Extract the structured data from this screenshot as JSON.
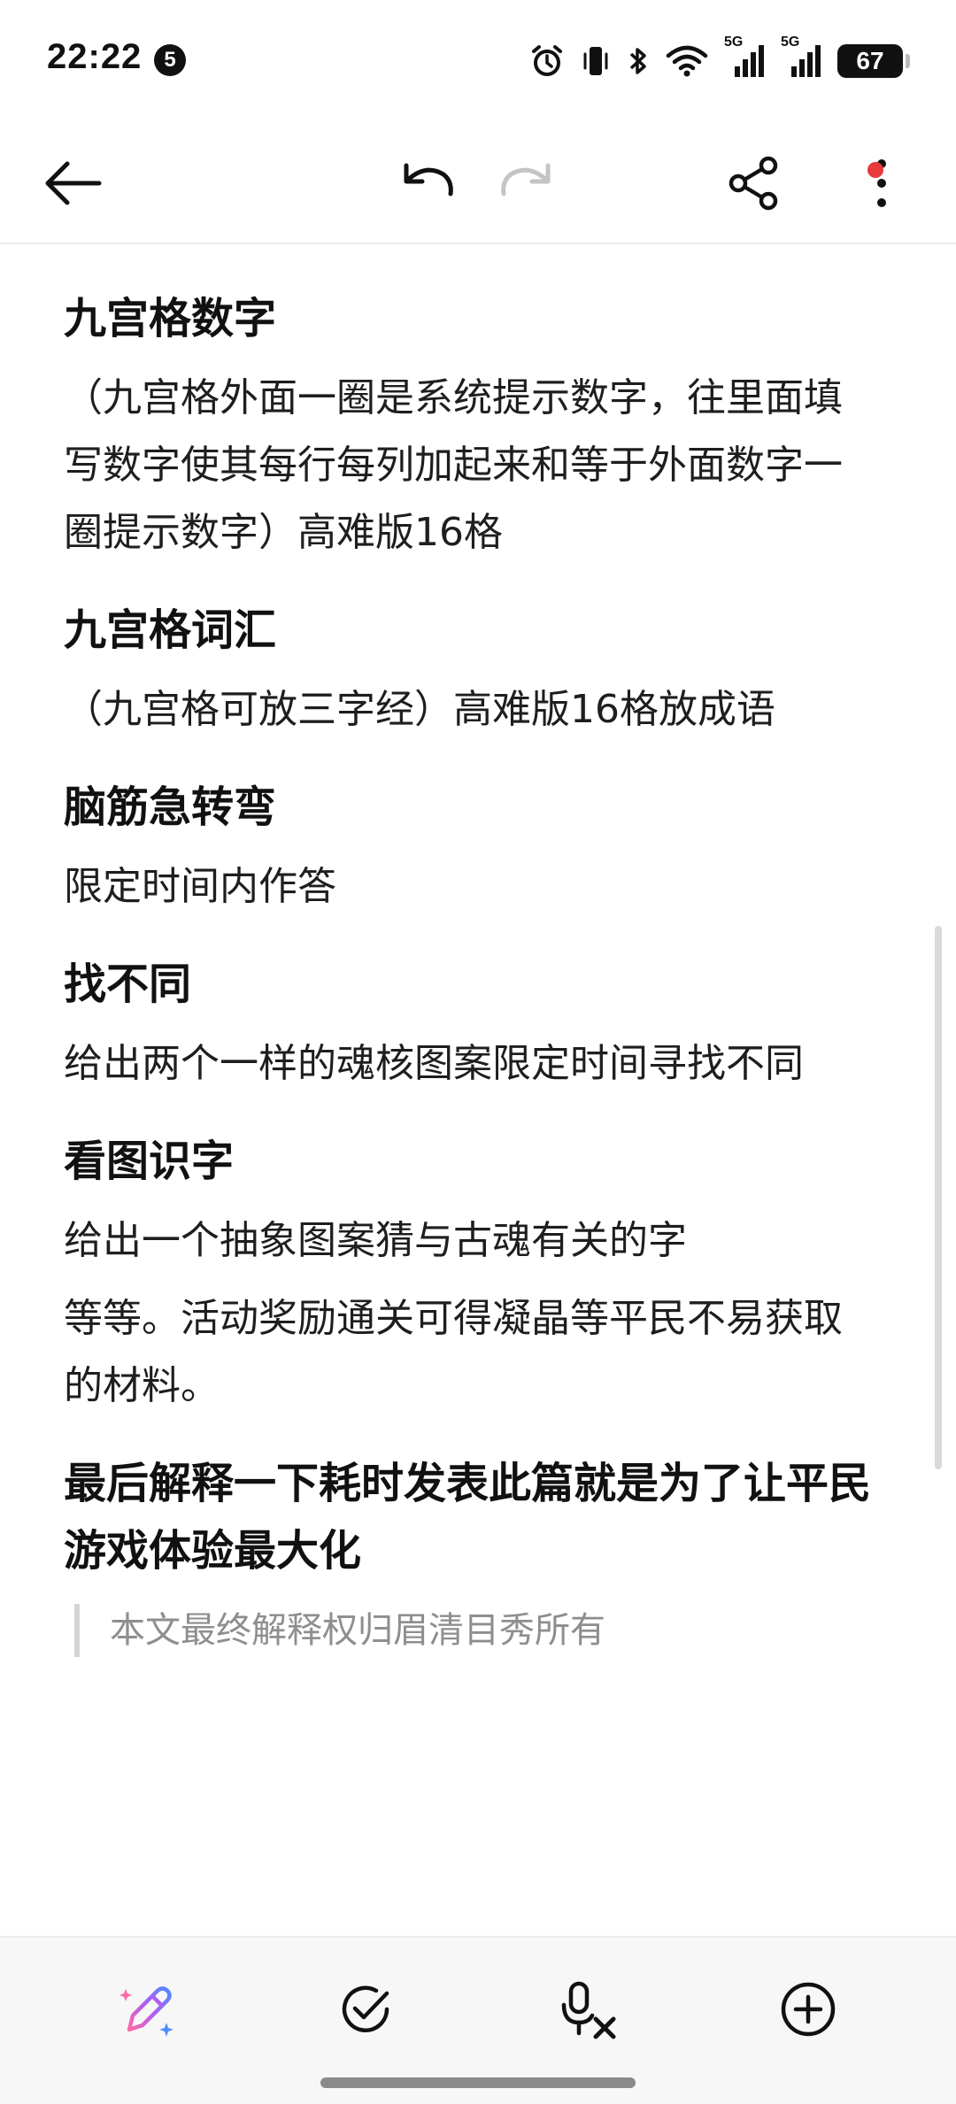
{
  "status_bar": {
    "time": "22:22",
    "notification_count": "5",
    "signal_label_1": "5G",
    "signal_label_2": "5G",
    "battery": "67"
  },
  "toolbar": {
    "back_icon": "arrow-left-icon",
    "undo_icon": "undo-icon",
    "redo_icon": "redo-icon",
    "share_icon": "share-icon",
    "more_icon": "more-vertical-icon"
  },
  "content": {
    "sections": [
      {
        "heading": "九宫格数字",
        "paragraphs": [
          "（九宫格外面一圈是系统提示数字，往里面填写数字使其每行每列加起来和等于外面数字一圈提示数字）高难版16格"
        ]
      },
      {
        "heading": "九宫格词汇",
        "paragraphs": [
          "（九宫格可放三字经）高难版16格放成语"
        ]
      },
      {
        "heading": "脑筋急转弯",
        "paragraphs": [
          "限定时间内作答"
        ]
      },
      {
        "heading": "找不同",
        "paragraphs": [
          "给出两个一样的魂核图案限定时间寻找不同"
        ]
      },
      {
        "heading": "看图识字",
        "paragraphs": [
          "给出一个抽象图案猜与古魂有关的字",
          "等等。活动奖励通关可得凝晶等平民不易获取的材料。"
        ]
      },
      {
        "heading": "最后解释一下耗时发表此篇就是为了让平民游戏体验最大化",
        "paragraphs": []
      }
    ],
    "quote": "本文最终解释权归眉清目秀所有"
  },
  "bottom_bar": {
    "ai_pen_icon": "ai-pen-icon",
    "check_icon": "check-circle-icon",
    "voice_text_icon": "voice-to-text-icon",
    "add_icon": "add-circle-icon"
  },
  "colors": {
    "text": "#111111",
    "quote": "#8e8e8e",
    "accent_red": "#e83a3a",
    "redo_disabled": "#c4c4c4"
  }
}
